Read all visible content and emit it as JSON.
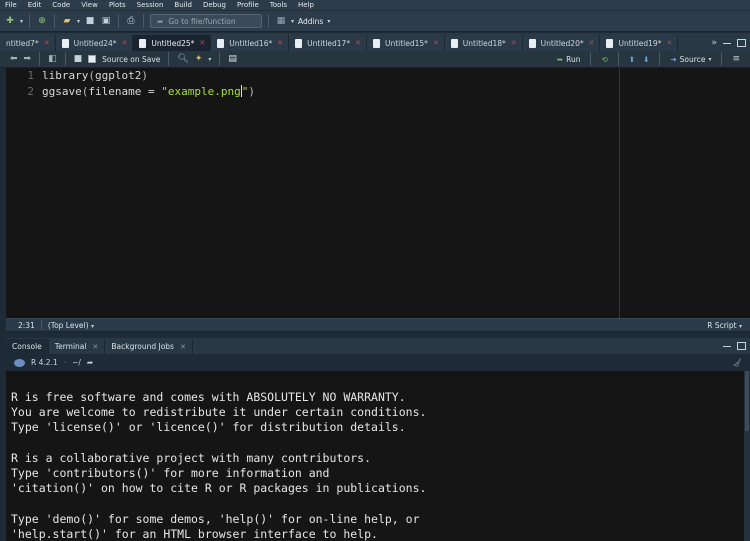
{
  "menu": [
    "File",
    "Edit",
    "Code",
    "View",
    "Plots",
    "Session",
    "Build",
    "Debug",
    "Profile",
    "Tools",
    "Help"
  ],
  "toolbar": {
    "goto_placeholder": "Go to file/function",
    "addins_label": "Addins"
  },
  "tabs": [
    {
      "label": "ntitled7*",
      "active": false
    },
    {
      "label": "Untitled24*",
      "active": false
    },
    {
      "label": "Untitled25*",
      "active": true
    },
    {
      "label": "Untitled16*",
      "active": false
    },
    {
      "label": "Untitled17*",
      "active": false
    },
    {
      "label": "Untitled15*",
      "active": false
    },
    {
      "label": "Untitled18*",
      "active": false
    },
    {
      "label": "Untitled20*",
      "active": false
    },
    {
      "label": "Untitled19*",
      "active": false
    }
  ],
  "editor_toolbar": {
    "source_on_save": "Source on Save",
    "run_label": "Run",
    "source_label": "Source"
  },
  "code_lines": [
    {
      "num": "1",
      "text": "library(ggplot2)"
    },
    {
      "num": "2",
      "text": "ggsave(filename = \"example.png\")"
    }
  ],
  "status": {
    "position": "2:31",
    "scope": "(Top Level)",
    "filetype": "R Script"
  },
  "console_tabs": [
    "Console",
    "Terminal",
    "Background Jobs"
  ],
  "console_header": {
    "version": "R 4.2.1",
    "path": "~/"
  },
  "console_lines": [
    "R is free software and comes with ABSOLUTELY NO WARRANTY.",
    "You are welcome to redistribute it under certain conditions.",
    "Type 'license()' or 'licence()' for distribution details.",
    "",
    "R is a collaborative project with many contributors.",
    "Type 'contributors()' for more information and",
    "'citation()' on how to cite R or R packages in publications.",
    "",
    "Type 'demo()' for some demos, 'help()' for on-line help, or",
    "'help.start()' for an HTML browser interface to help."
  ]
}
